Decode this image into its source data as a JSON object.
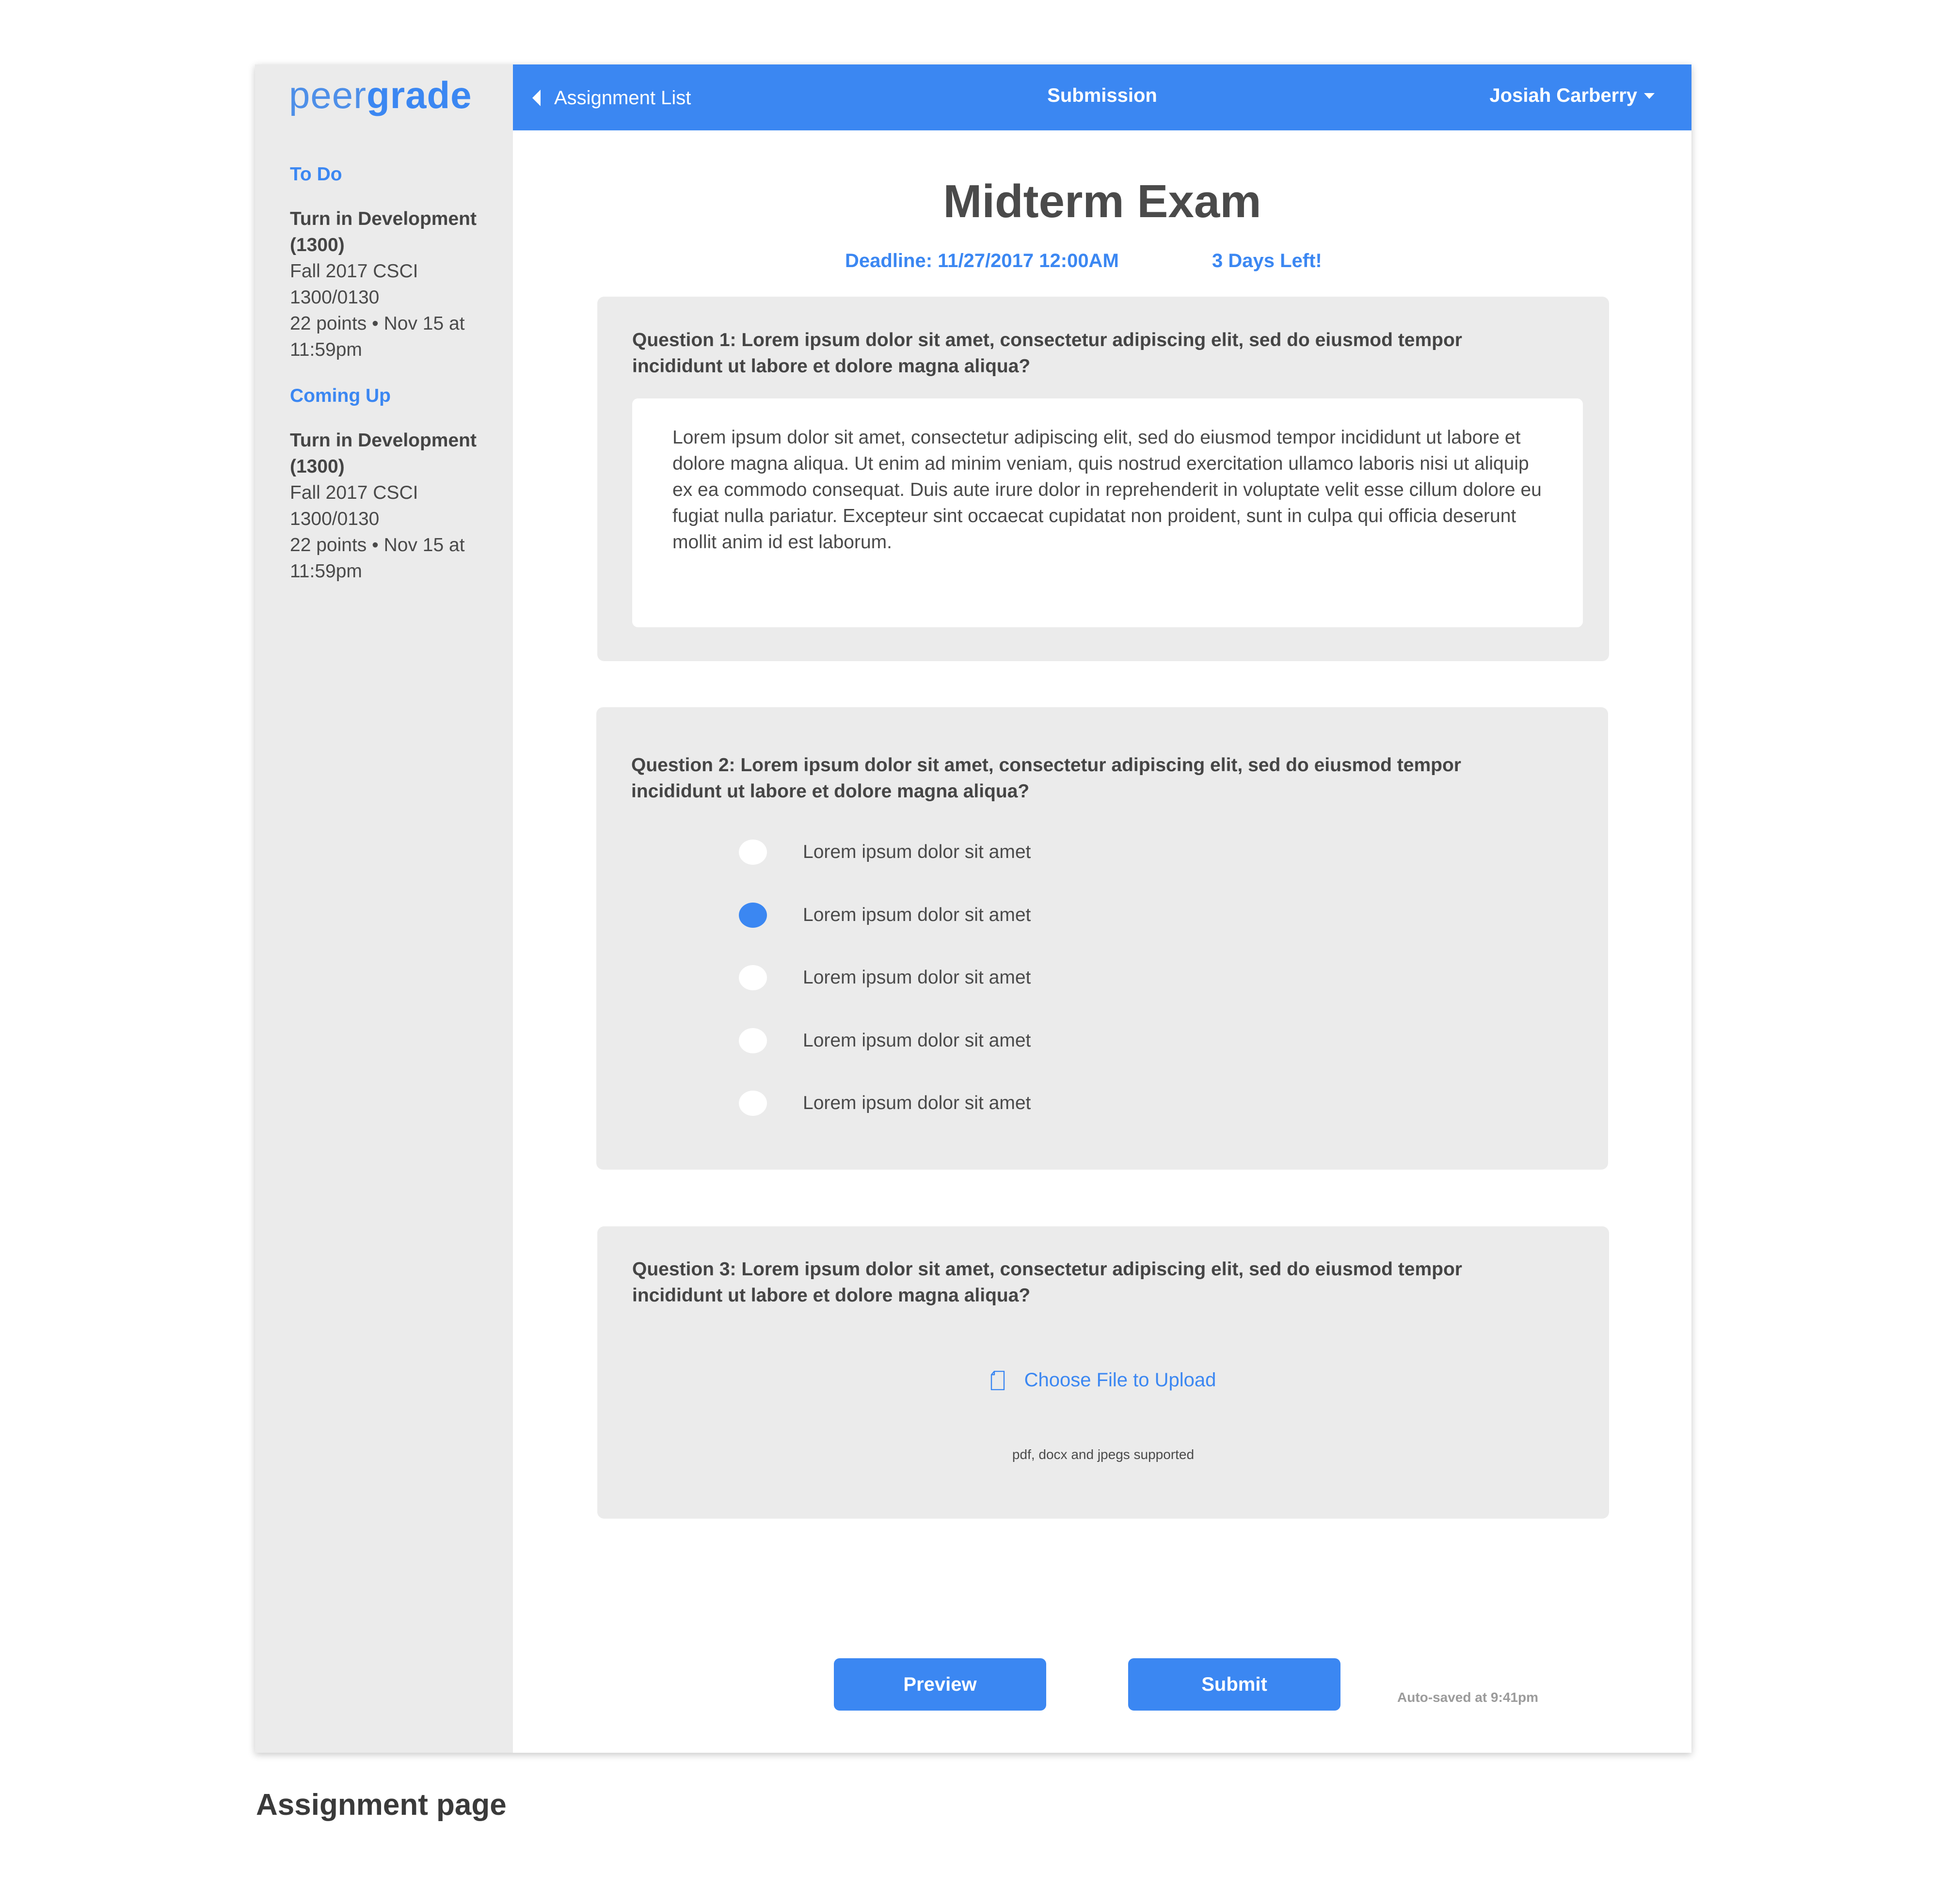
{
  "brand": {
    "logo_part1": "peer",
    "logo_part2": "grade",
    "accent_color": "#3b87f2"
  },
  "sidebar": {
    "todo_title": "To Do",
    "todo_item": {
      "title_line1": "Turn in Development",
      "title_line2": "(1300)",
      "course_line1": "Fall 2017 CSCI",
      "course_line2": "1300/0130",
      "meta_line1": "22 points • Nov 15 at",
      "meta_line2": "11:59pm"
    },
    "coming_up_title": "Coming Up",
    "coming_item": {
      "title_line1": "Turn in Development",
      "title_line2": "(1300)",
      "course_line1": "Fall 2017 CSCI",
      "course_line2": "1300/0130",
      "meta_line1": "22 points • Nov 15 at",
      "meta_line2": "11:59pm"
    }
  },
  "topbar": {
    "back_label": "Assignment List",
    "title": "Submission",
    "user_name": "Josiah Carberry",
    "back_icon": "caret-left-icon",
    "user_menu_icon": "caret-down-icon"
  },
  "exam": {
    "title": "Midterm Exam",
    "deadline": "Deadline: 11/27/2017 12:00AM",
    "days_left": "3 Days Left!"
  },
  "questions": [
    {
      "text": "Question 1: Lorem ipsum dolor sit amet, consectetur adipiscing elit, sed do eiusmod tempor incididunt ut labore et dolore magna aliqua?",
      "answer": "Lorem ipsum dolor sit amet, consectetur adipiscing elit, sed do eiusmod tempor incididunt ut labore et dolore magna aliqua. Ut enim ad minim veniam, quis nostrud exercitation ullamco laboris nisi ut aliquip ex ea commodo consequat. Duis aute irure dolor in reprehenderit in voluptate velit esse cillum dolore eu fugiat nulla pariatur. Excepteur sint occaecat cupidatat non proident, sunt in culpa qui officia deserunt mollit anim id est laborum."
    },
    {
      "text": "Question 2: Lorem ipsum dolor sit amet, consectetur adipiscing elit, sed do eiusmod tempor incididunt ut labore et dolore magna aliqua?",
      "options": [
        {
          "label": "Lorem ipsum dolor sit amet",
          "selected": false
        },
        {
          "label": "Lorem ipsum dolor sit amet",
          "selected": true
        },
        {
          "label": "Lorem ipsum dolor sit amet",
          "selected": false
        },
        {
          "label": "Lorem ipsum dolor sit amet",
          "selected": false
        },
        {
          "label": "Lorem ipsum dolor sit amet",
          "selected": false
        }
      ]
    },
    {
      "text": "Question 3: Lorem ipsum dolor sit amet, consectetur adipiscing elit, sed do eiusmod tempor incididunt ut labore et dolore magna aliqua?",
      "upload_label": "Choose File to Upload",
      "upload_note": "pdf, docx and jpegs supported",
      "upload_icon": "file-icon"
    }
  ],
  "actions": {
    "preview_label": "Preview",
    "submit_label": "Submit",
    "autosave": "Auto-saved at 9:41pm"
  },
  "caption": "Assignment page"
}
